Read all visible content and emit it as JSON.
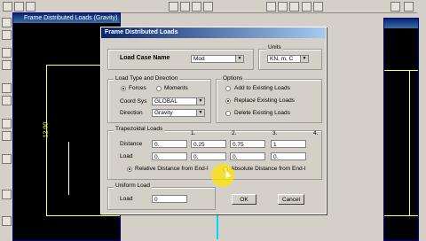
{
  "background_window": {
    "title": "Frame Distributed Loads (Gravity)"
  },
  "dialog": {
    "title": "Frame Distributed Loads",
    "load_case_label": "Load Case Name",
    "load_case_value": "Mod",
    "units_label": "Units",
    "units_value": "KN, m, C",
    "load_type_group": "Load Type and Direction",
    "forces_label": "Forces",
    "moments_label": "Moments",
    "coord_sys_label": "Coord Sys",
    "coord_sys_value": "GLOBAL",
    "direction_label": "Direction",
    "direction_value": "Gravity",
    "options_group": "Options",
    "opt_add": "Add to Existing Loads",
    "opt_replace": "Replace Existing Loads",
    "opt_delete": "Delete Existing Loads",
    "trap_group": "Trapezoidal Loads",
    "col_headers": [
      "1.",
      "2.",
      "3.",
      "4."
    ],
    "distance_label": "Distance",
    "distance_values": [
      "0.",
      "0.25",
      "0.75",
      "1"
    ],
    "load_label": "Load",
    "load_values": [
      "0.",
      "0.",
      "0.",
      "0."
    ],
    "relative_label": "Relative Distance from End-I",
    "absolute_label": "Absolute Distance from End-I",
    "uniform_group": "Uniform Load",
    "uniform_load_label": "Load",
    "uniform_load_value": "0",
    "ok_label": "OK",
    "cancel_label": "Cancel"
  },
  "frame_label": "12.00",
  "colors": {
    "title_bar": "#0a246a",
    "frame_lines": "#ffff66",
    "highlight": "#ffe600"
  }
}
